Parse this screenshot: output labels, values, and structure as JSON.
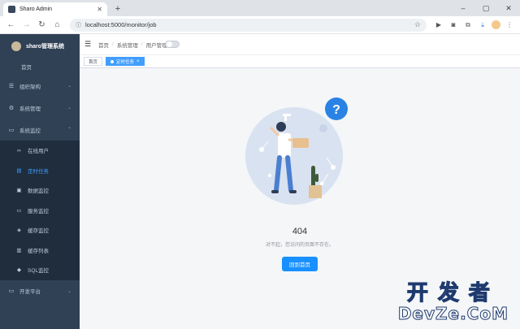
{
  "browser": {
    "tab_title": "Sharo Admin",
    "new_tab": "+",
    "url": "localhost:5000/monitor/job",
    "window_controls": [
      "–",
      "▢",
      "✕"
    ]
  },
  "brand": {
    "title": "sharo管理系统"
  },
  "sidebar": {
    "home": "首页",
    "groups": [
      {
        "icon": "list-icon",
        "label": "组织架构"
      },
      {
        "icon": "gear-icon",
        "label": "系统管理"
      },
      {
        "icon": "monitor-icon",
        "label": "系统监控"
      }
    ],
    "sub_items": [
      {
        "icon": "online-icon",
        "label": "在线用户"
      },
      {
        "icon": "job-icon",
        "label": "定时任务"
      },
      {
        "icon": "data-icon",
        "label": "数据监控"
      },
      {
        "icon": "server-icon",
        "label": "服务监控"
      },
      {
        "icon": "cache-icon",
        "label": "缓存监控"
      },
      {
        "icon": "cache-list-icon",
        "label": "缓存列表"
      },
      {
        "icon": "sql-icon",
        "label": "SQL监控"
      }
    ],
    "dev": {
      "icon": "dev-icon",
      "label": "开发平台"
    }
  },
  "breadcrumb": [
    "首页",
    "系统管理",
    "用户管理"
  ],
  "tags": [
    {
      "label": "首页",
      "active": false
    },
    {
      "label": "定时任务",
      "active": true
    }
  ],
  "error": {
    "code": "404",
    "message": "对不起，您访问的页面不存在。",
    "back_label": "回到首页"
  },
  "watermark": {
    "line1": "开发者",
    "line2": "DevZe.CoM"
  },
  "colors": {
    "sidebar": "#304156",
    "submenu": "#1f2d3d",
    "accent": "#409eff",
    "button": "#1890ff"
  }
}
